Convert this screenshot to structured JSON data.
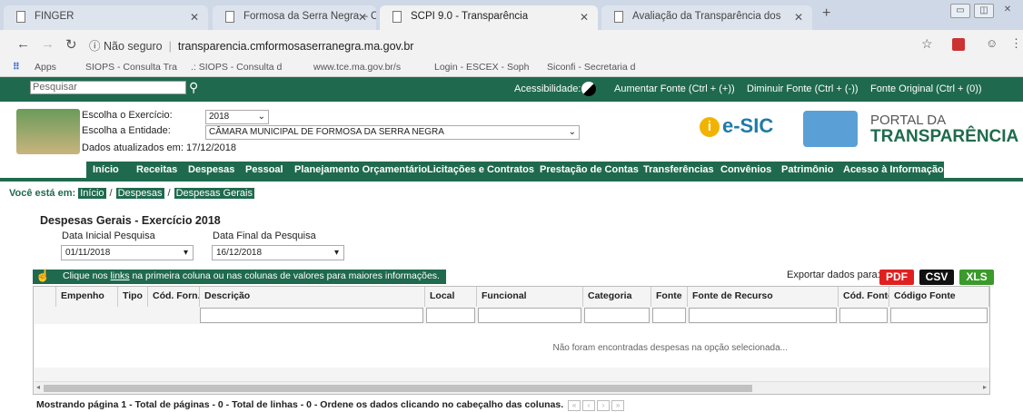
{
  "browser": {
    "tabs": [
      {
        "label": "FINGER"
      },
      {
        "label": "Formosa da Serra Negra – Câma"
      },
      {
        "label": "SCPI 9.0 - Transparência"
      },
      {
        "label": "Avaliação da Transparência dos"
      }
    ],
    "url_secure": "Não seguro",
    "url": "transparencia.cmformosaserranegra.ma.gov.br",
    "bookmarks": [
      "Apps",
      "SIOPS - Consulta Tra",
      ".: SIOPS - Consulta d",
      "www.tce.ma.gov.br/s",
      "Login - ESCEX - Soph",
      "Siconfi - Secretaria d"
    ]
  },
  "topbar": {
    "search_placeholder": "Pesquisar",
    "accessibility": "Acessibilidade:",
    "increase": "Aumentar Fonte (Ctrl + (+))",
    "decrease": "Diminuir Fonte (Ctrl + (-))",
    "original": "Fonte Original (Ctrl + (0))"
  },
  "header": {
    "exercise_label": "Escolha o Exercício:",
    "exercise_value": "2018",
    "entity_label": "Escolha a Entidade:",
    "entity_value": "CÂMARA MUNICIPAL DE FORMOSA DA SERRA NEGRA",
    "updated": "Dados atualizados em: 17/12/2018",
    "esic": "e-SIC",
    "portal_line1": "PORTAL DA",
    "portal_line2": "TRANSPARÊNCIA"
  },
  "menu": [
    "Início",
    "Receitas",
    "Despesas",
    "Pessoal",
    "Planejamento Orçamentário",
    "Licitações e Contratos",
    "Prestação de Contas",
    "Transferências",
    "Convênios",
    "Patrimônio",
    "Acesso à Informação"
  ],
  "breadcrumb": {
    "prefix": "Você está em:",
    "items": [
      "Início",
      "Despesas",
      "Despesas Gerais"
    ]
  },
  "page": {
    "title": "Despesas Gerais - Exercício 2018",
    "start_label": "Data Inicial Pesquisa",
    "start_value": "01/11/2018",
    "end_label": "Data Final da Pesquisa",
    "end_value": "16/12/2018",
    "info_pre": "Clique nos ",
    "info_link": "links",
    "info_post": " na primeira coluna ou nas colunas de valores para maiores informações.",
    "export_label": "Exportar dados para:",
    "export": [
      "PDF",
      "CSV",
      "XLS"
    ]
  },
  "table": {
    "columns": [
      "Empenho",
      "Tipo",
      "Cód. Forn.",
      "Descrição",
      "Local",
      "Funcional",
      "Categoria",
      "Fonte",
      "Fonte de Recurso",
      "Cód. Fonte",
      "Código Fonte"
    ],
    "empty": "Não foram encontradas despesas na opção selecionada..."
  },
  "footer": "Mostrando página 1 - Total de páginas - 0 - Total de linhas - 0 - Ordene os dados clicando no cabeçalho das colunas.",
  "colors": {
    "green": "#1f6a4e",
    "pdf": "#e02020",
    "csv": "#111111",
    "xls": "#3a9a2a"
  }
}
